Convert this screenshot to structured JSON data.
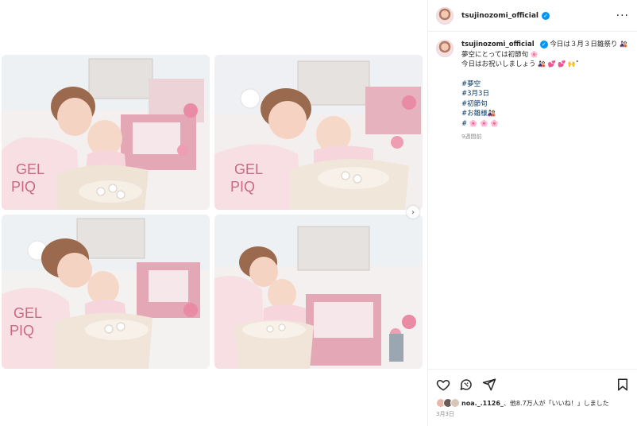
{
  "account": {
    "username": "tsujinozomi_official",
    "verified": true
  },
  "header": {
    "more_icon": "ellipsis-icon"
  },
  "caption": {
    "username": "tsujinozomi_official",
    "line1": "今日は３月３日雛祭り",
    "line1_emoji": "🎎",
    "line2": "夢空にとっては初節句",
    "line2_emoji": "🌸",
    "line3": "今日はお祝いしましょう",
    "line3_emoji": "🎎 💕 💕 🙌˚",
    "hashtags": [
      "#夢空",
      "#3月3日",
      "#初節句",
      "#お雛様🎎",
      "# 🌸 🌸 🌸"
    ],
    "time_ago": "9週間前"
  },
  "photos": [
    {
      "subject": "mother-kissing-baby"
    },
    {
      "subject": "baby-laughing-in-highchair"
    },
    {
      "subject": "mother-leaning-to-baby"
    },
    {
      "subject": "mother-and-baby-hina-dolls"
    }
  ],
  "actions": {
    "like_icon": "heart-icon",
    "comment_icon": "comment-icon",
    "share_icon": "share-icon",
    "save_icon": "bookmark-icon"
  },
  "likes": {
    "first_liker": "noa._.1126_",
    "text": "、他8.7万人が「いいね！」しました"
  },
  "post_date": "3月3日",
  "colors": {
    "link": "#00376b",
    "verified": "#0095f6",
    "muted": "#8e8e8e",
    "sweater": "#f7dfe3",
    "hina_pink": "#e8a7b6"
  }
}
